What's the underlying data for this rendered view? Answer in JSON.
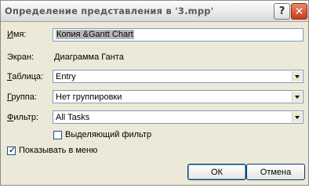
{
  "window": {
    "title": "Определение представления в '3.mpp'",
    "help_glyph": "?",
    "close_glyph": "✕"
  },
  "form": {
    "name_label_accel": "И",
    "name_label_rest": "мя:",
    "name_value": "Копия &Gantt Chart",
    "screen_label": "Экран:",
    "screen_value": "Диаграмма Ганта",
    "table_label_accel": "Т",
    "table_label_rest": "аблица:",
    "table_value": "Entry",
    "group_label_accel": "Г",
    "group_label_rest": "руппа:",
    "group_value": "Нет группировки",
    "filter_label_accel": "Ф",
    "filter_label_rest": "ильтр:",
    "filter_value": "All Tasks",
    "highlight_filter_label": "Выделяющий фильтр",
    "highlight_filter_checked": false,
    "show_in_menu_label": "Показывать в меню",
    "show_in_menu_checked": true,
    "check_glyph": "✓"
  },
  "buttons": {
    "ok": "ОК",
    "cancel": "Отмена"
  }
}
